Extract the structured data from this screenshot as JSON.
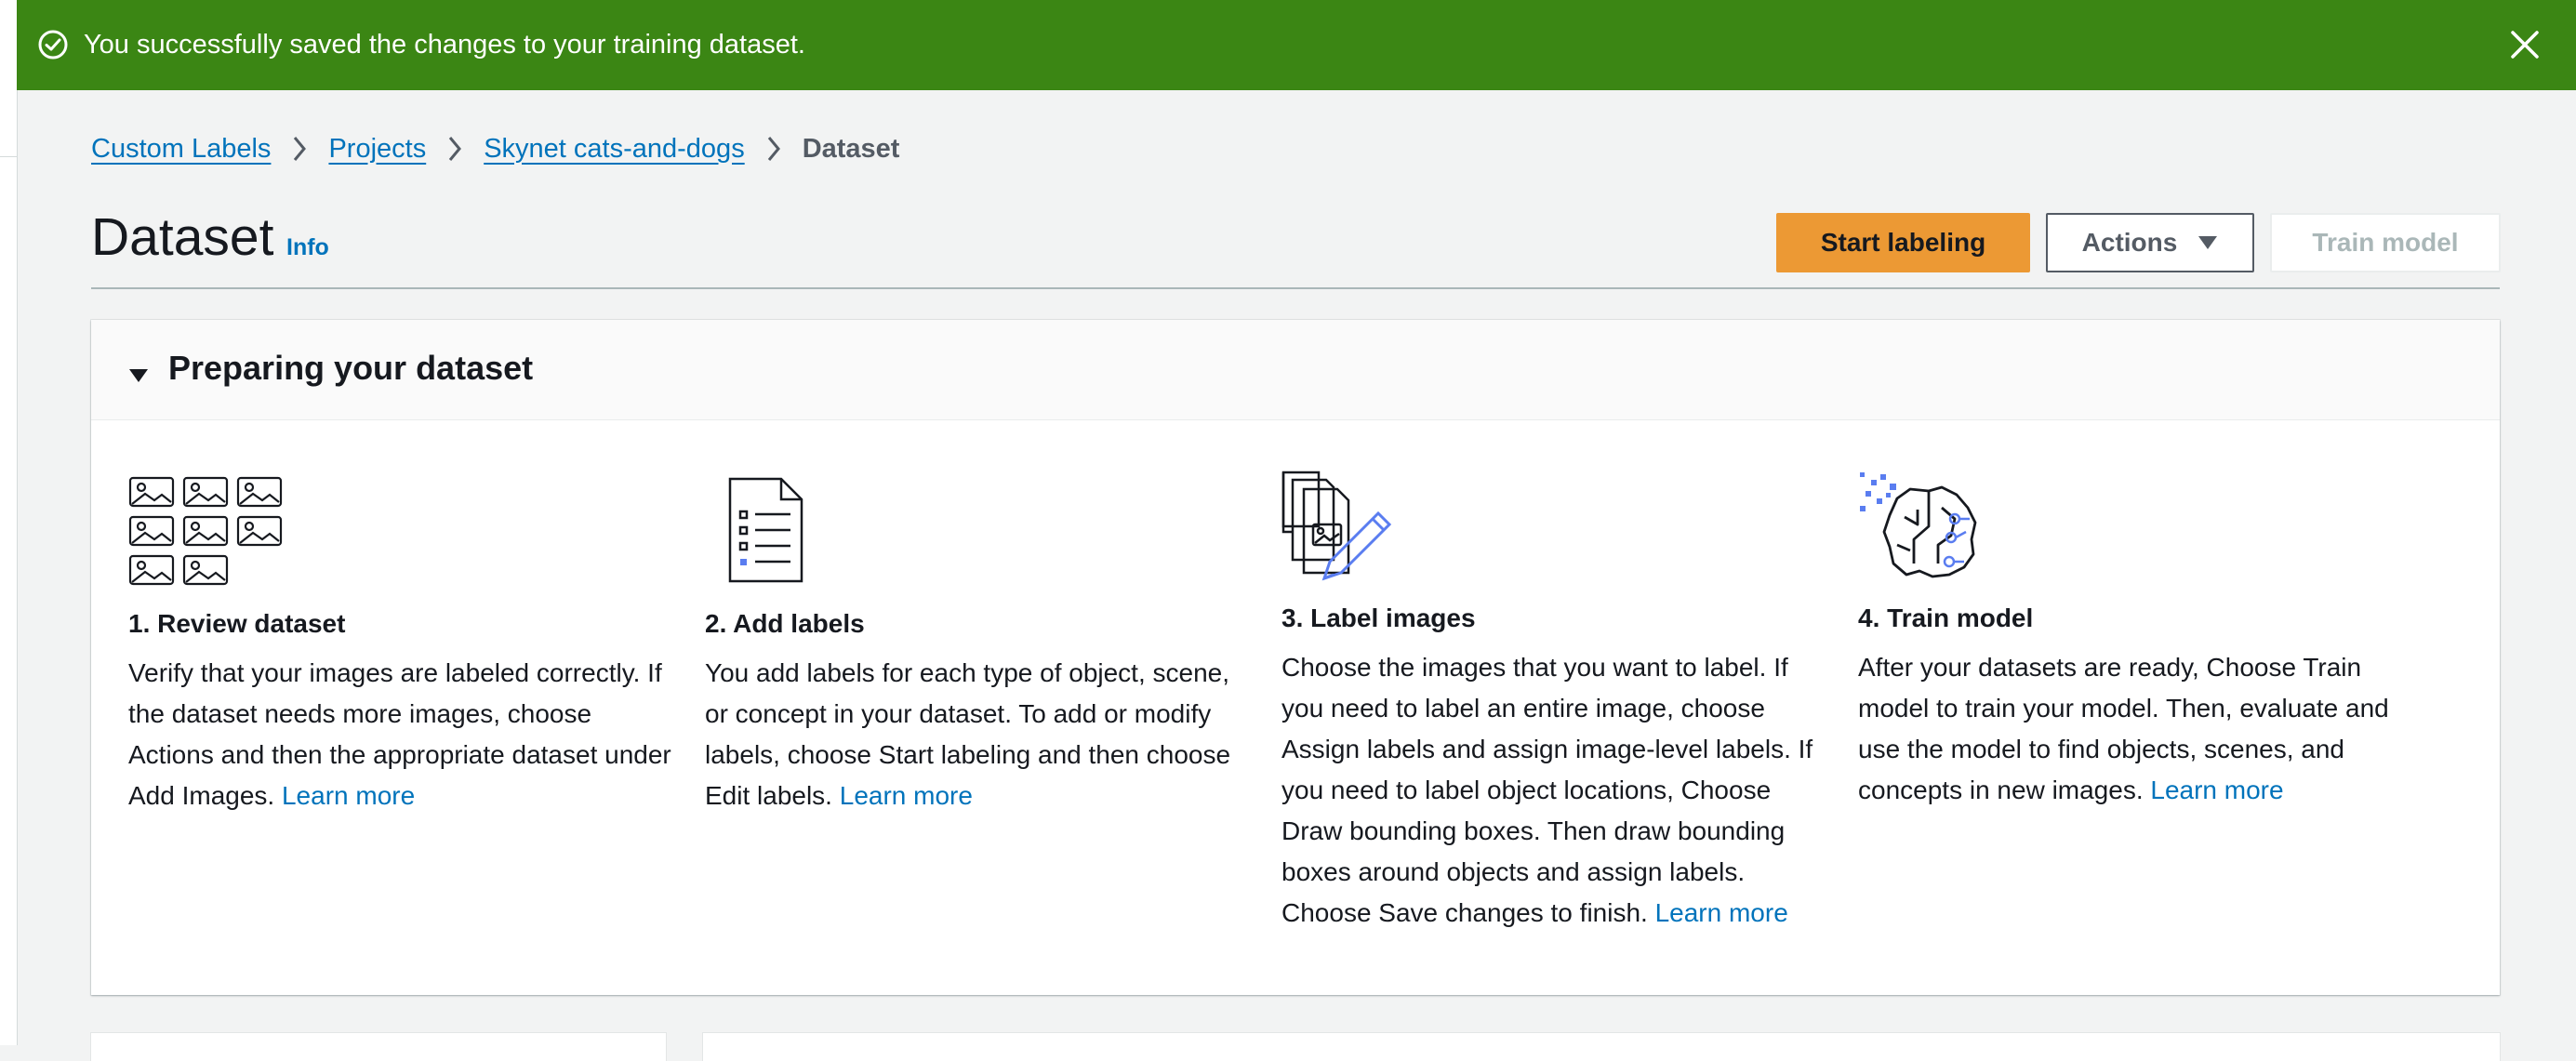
{
  "flash": {
    "message": "You successfully saved the changes to your training dataset.",
    "color": "#3b8614",
    "icon": "check-circle-icon",
    "close_icon": "close-icon"
  },
  "breadcrumb": {
    "items": [
      "Custom Labels",
      "Projects",
      "Skynet cats-and-dogs"
    ],
    "current": "Dataset"
  },
  "header": {
    "title": "Dataset",
    "info": "Info",
    "start_labeling": "Start labeling",
    "actions": "Actions",
    "train_model": "Train model"
  },
  "panel": {
    "title": "Preparing your dataset",
    "steps": [
      {
        "title": "1. Review dataset",
        "body": "Verify that your images are labeled correctly. If the dataset needs more images, choose Actions and then the appropriate dataset under Add Images.",
        "link": "Learn more",
        "icon": "image-grid-icon"
      },
      {
        "title": "2. Add labels",
        "body": "You add labels for each type of object, scene, or concept in your dataset. To add or modify labels, choose Start labeling and then choose Edit labels.",
        "link": "Learn more",
        "icon": "document-list-icon"
      },
      {
        "title": "3. Label images",
        "body": "Choose the images that you want to label. If you need to label an entire image, choose Assign labels and assign image-level labels. If you need to label object locations, Choose Draw bounding boxes. Then draw bounding boxes around objects and assign labels. Choose Save changes to finish.",
        "link": "Learn more",
        "icon": "label-images-icon"
      },
      {
        "title": "4. Train model",
        "body": "After your datasets are ready, Choose Train model to train your model. Then, evaluate and use the model to find objects, scenes, and concepts in new images.",
        "link": "Learn more",
        "icon": "brain-icon"
      }
    ]
  },
  "colors": {
    "primary_button": "#ec9934",
    "link": "#0073bb",
    "icon_accent": "#5a7df0"
  }
}
